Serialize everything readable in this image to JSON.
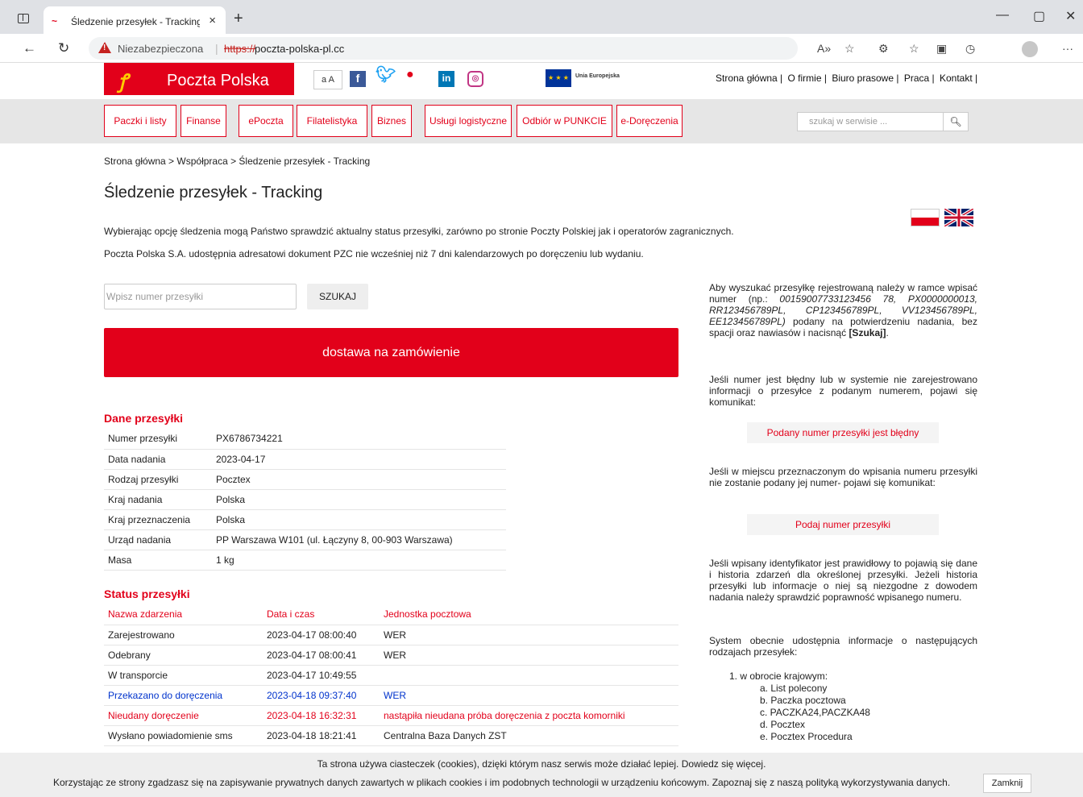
{
  "browser": {
    "tab_title": "Śledzenie przesyłek - Tracking | e",
    "insecure_label": "Niezabezpieczona",
    "url_protocol": "https://",
    "url_host": "poczta-polska-pl.cc"
  },
  "header": {
    "brand_name": "Poczta Polska",
    "font_toggle": "a A",
    "eu_label": "Unia Europejska",
    "top_links": [
      "Strona główna |",
      "O firmie |",
      "Biuro prasowe |",
      "Praca |",
      "Kontakt |"
    ]
  },
  "menu": {
    "items": [
      "Paczki i listy",
      "Finanse",
      "ePoczta",
      "Filatelistyka",
      "Biznes",
      "Usługi logistyczne",
      "Odbiór w PUNKCIE",
      "e-Doręczenia"
    ],
    "search_placeholder": "szukaj w serwisie ..."
  },
  "breadcrumb": "Strona główna > Współpraca > Śledzenie przesyłek - Tracking",
  "page_title": "Śledzenie przesyłek - Tracking",
  "intro": [
    "Wybierając opcję śledzenia mogą Państwo sprawdzić aktualny status przesyłki, zarówno po stronie Poczty Polskiej jak i operatorów zagranicznych.",
    "Poczta Polska S.A. udostępnia adresatowi dokument PZC nie wcześniej niż 7 dni kalendarzowych po doręczeniu lub wydaniu."
  ],
  "tracking": {
    "input_placeholder": "Wpisz numer przesyłki",
    "search_button": "SZUKAJ",
    "cta": "dostawa na zamówienie"
  },
  "shipment": {
    "title": "Dane przesyłki",
    "rows": [
      [
        "Numer przesyłki",
        "PX6786734221"
      ],
      [
        "Data nadania",
        "2023-04-17"
      ],
      [
        "Rodzaj przesyłki",
        "Pocztex"
      ],
      [
        "Kraj nadania",
        "Polska"
      ],
      [
        "Kraj przeznaczenia",
        "Polska"
      ],
      [
        "Urząd nadania",
        "PP Warszawa W101 (ul. Łączyny 8, 00-903 Warszawa)"
      ],
      [
        "Masa",
        "1 kg"
      ]
    ]
  },
  "status": {
    "title": "Status przesyłki",
    "headers": [
      "Nazwa zdarzenia",
      "Data i czas",
      "Jednostka pocztowa"
    ],
    "rows": [
      [
        "Zarejestrowano",
        "2023-04-17 08:00:40",
        "WER"
      ],
      [
        "Odebrany",
        "2023-04-17 08:00:41",
        "WER"
      ],
      [
        "W transporcie",
        "2023-04-17 10:49:55",
        ""
      ],
      [
        "Przekazano do doręczenia",
        "2023-04-18 09:37:40",
        "WER"
      ],
      [
        "Nieudany doręczenie",
        "2023-04-18 16:32:31",
        "nastąpiła nieudana próba doręczenia z poczta komorniki"
      ],
      [
        "Wysłano powiadomienie sms",
        "2023-04-18 18:21:41",
        "Centralna Baza Danych ZST"
      ]
    ]
  },
  "help": {
    "p1_a": "Aby wyszukać przesyłkę rejestrowaną należy w ramce wpisać numer (np.:",
    "p1_examples": "00159007733123456 78, PX0000000013, RR123456789PL, CP123456789PL, VV123456789PL, EE123456789PL)",
    "p1_b": "podany na potwierdzeniu nadania, bez spacji oraz nawiasów i nacisnąć",
    "p1_btn": "[Szukaj]",
    "p2": "Jeśli numer jest błędny lub w systemie nie zarejestrowano informacji o przesyłce z podanym numerem, pojawi się komunikat:",
    "msg1": "Podany numer przesyłki jest błędny",
    "p3": "Jeśli w miejscu przeznaczonym do wpisania numeru przesyłki nie zostanie podany jej numer- pojawi się komunikat:",
    "msg2": "Podaj numer przesyłki",
    "p4": "Jeśli wpisany identyfikator jest prawidłowy to pojawią się dane i historia zdarzeń dla określonej przesyłki. Jeżeli historia przesyłki lub informacje o niej są niezgodne z dowodem nadania należy sprawdzić poprawność wpisanego numeru.",
    "p5": "System obecnie udostępnia informacje o następujących rodzajach przesyłek:",
    "list_head": "1. w obrocie krajowym:",
    "list_items": [
      "a. List polecony",
      "b. Paczka pocztowa",
      "c. PACZKA24,PACZKA48",
      "d. Pocztex",
      "e. Pocztex Procedura"
    ]
  },
  "cookie": {
    "line1": "Ta strona używa ciasteczek (cookies), dzięki którym nasz serwis może działać lepiej. Dowiedz się więcej.",
    "line2": "Korzystając ze strony zgadzasz się na zapisywanie prywatnych danych zawartych w plikach cookies i im podobnych technologii w urządzeniu końcowym. Zapoznaj się z naszą polityką wykorzystywania danych.",
    "close": "Zamknij"
  }
}
